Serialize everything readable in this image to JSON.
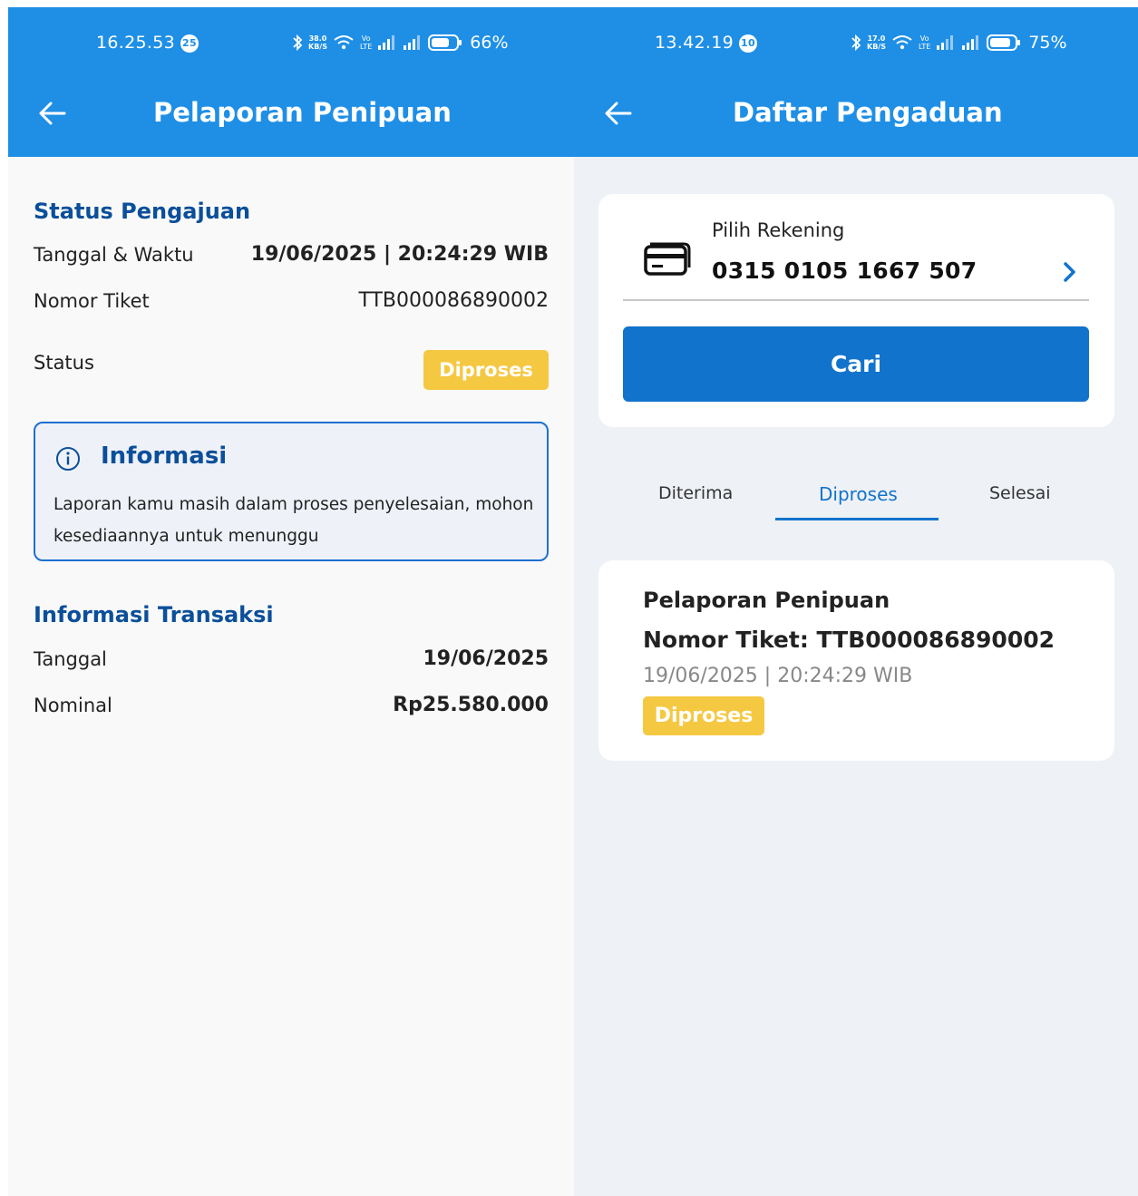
{
  "left": {
    "statusbar": {
      "time": "16.25.53",
      "notif_count": "25",
      "speed": "38.0",
      "speed_unit": "KB/S",
      "volte": "Vo",
      "volte_sub": "LTE",
      "battery": "66%"
    },
    "nav": {
      "title": "Pelaporan Penipuan"
    },
    "status_section": {
      "heading": "Status Pengajuan",
      "datetime_label": "Tanggal & Waktu",
      "datetime_value": "19/06/2025 | 20:24:29 WIB",
      "ticket_label": "Nomor Tiket",
      "ticket_value": "TTB000086890002",
      "status_label": "Status",
      "status_value": "Diproses"
    },
    "info_box": {
      "title": "Informasi",
      "text": "Laporan kamu masih dalam proses penyelesaian, mohon kesediaannya untuk menunggu"
    },
    "transaction": {
      "heading": "Informasi Transaksi",
      "date_label": "Tanggal",
      "date_value": "19/06/2025",
      "amount_label": "Nominal",
      "amount_value": "Rp25.580.000"
    }
  },
  "right": {
    "statusbar": {
      "time": "13.42.19",
      "notif_count": "10",
      "speed": "17.0",
      "speed_unit": "KB/S",
      "volte": "Vo",
      "volte_sub": "LTE",
      "battery": "75%"
    },
    "nav": {
      "title": "Daftar Pengaduan"
    },
    "account": {
      "label": "Pilih Rekening",
      "number": "0315 0105 1667 507"
    },
    "search_button": "Cari",
    "tabs": [
      {
        "label": "Diterima"
      },
      {
        "label": "Diproses",
        "active": true
      },
      {
        "label": "Selesai"
      }
    ],
    "ticket_item": {
      "title": "Pelaporan Penipuan",
      "ticket": "Nomor Tiket: TTB000086890002",
      "datetime": "19/06/2025 | 20:24:29 WIB",
      "status": "Diproses"
    }
  },
  "colors": {
    "header": "#1f8fe6",
    "heading": "#0b4f9a",
    "accent": "#1173cc",
    "badge": "#f5c842"
  }
}
